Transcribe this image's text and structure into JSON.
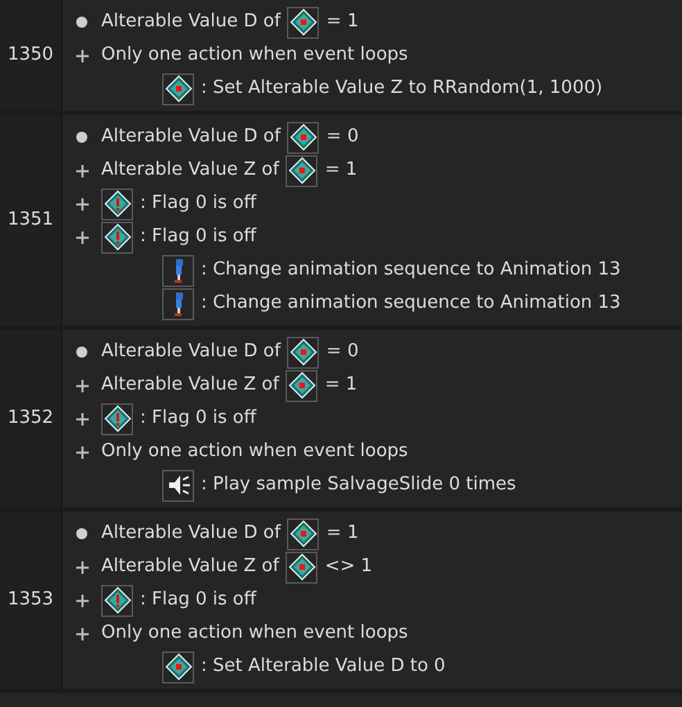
{
  "events": [
    {
      "number": "1350",
      "lines": [
        {
          "kind": "first-condition",
          "before": "Alterable Value D of",
          "object": {
            "kind": "counter"
          },
          "after": "= 1"
        },
        {
          "kind": "and-condition",
          "before": "Only one action when event loops"
        },
        {
          "kind": "action",
          "object": {
            "kind": "counter"
          },
          "after": ": Set Alterable Value Z to RRandom(1, 1000)"
        }
      ]
    },
    {
      "number": "1351",
      "lines": [
        {
          "kind": "first-condition",
          "before": "Alterable Value D of",
          "object": {
            "kind": "counter"
          },
          "after": "= 0"
        },
        {
          "kind": "and-condition",
          "before": "Alterable Value Z of",
          "object": {
            "kind": "counter"
          },
          "after": "= 1"
        },
        {
          "kind": "and-condition",
          "object": {
            "kind": "flag"
          },
          "after": ": Flag 0 is off"
        },
        {
          "kind": "and-condition",
          "object": {
            "kind": "flag"
          },
          "after": ": Flag 0 is off"
        },
        {
          "kind": "action",
          "object": {
            "kind": "sprite"
          },
          "after": ": Change animation sequence to Animation 13"
        },
        {
          "kind": "action",
          "object": {
            "kind": "sprite"
          },
          "after": ": Change animation sequence to Animation 13"
        }
      ]
    },
    {
      "number": "1352",
      "lines": [
        {
          "kind": "first-condition",
          "before": "Alterable Value D of",
          "object": {
            "kind": "counter"
          },
          "after": "= 0"
        },
        {
          "kind": "and-condition",
          "before": "Alterable Value Z of",
          "object": {
            "kind": "counter"
          },
          "after": "= 1"
        },
        {
          "kind": "and-condition",
          "object": {
            "kind": "flag"
          },
          "after": ": Flag 0 is off"
        },
        {
          "kind": "and-condition",
          "before": "Only one action when event loops"
        },
        {
          "kind": "action",
          "object": {
            "kind": "sound"
          },
          "after": ": Play sample SalvageSlide 0 times"
        }
      ]
    },
    {
      "number": "1353",
      "lines": [
        {
          "kind": "first-condition",
          "before": "Alterable Value D of",
          "object": {
            "kind": "counter"
          },
          "after": "= 1"
        },
        {
          "kind": "and-condition",
          "before": "Alterable Value Z of",
          "object": {
            "kind": "counter"
          },
          "after": "<> 1"
        },
        {
          "kind": "and-condition",
          "object": {
            "kind": "flag"
          },
          "after": ": Flag 0 is off"
        },
        {
          "kind": "and-condition",
          "before": "Only one action when event loops"
        },
        {
          "kind": "action",
          "object": {
            "kind": "counter"
          },
          "after": ": Set Alterable Value D to 0"
        }
      ]
    }
  ]
}
